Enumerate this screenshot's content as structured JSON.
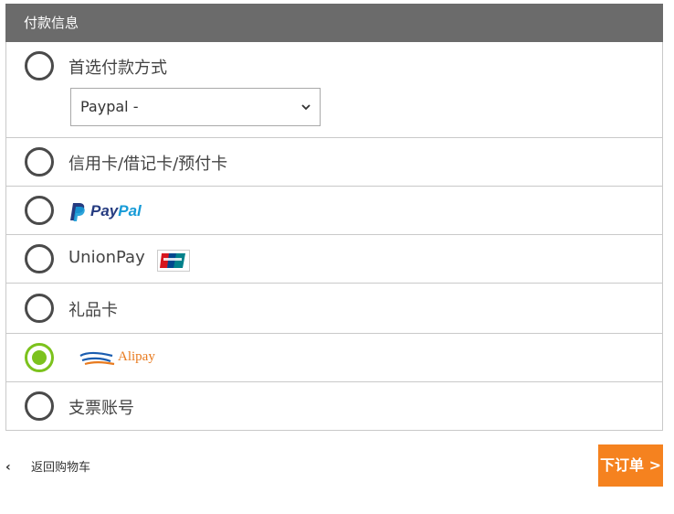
{
  "header": {
    "title": "付款信息"
  },
  "options": {
    "preferred": {
      "label": "首选付款方式",
      "select_value": "Paypal -",
      "selected": false
    },
    "card": {
      "label": "信用卡/借记卡/预付卡",
      "selected": false
    },
    "paypal": {
      "logo_part1": "Pay",
      "logo_part2": "Pal",
      "selected": false
    },
    "unionpay": {
      "label": "UnionPay",
      "selected": false
    },
    "giftcard": {
      "label": "礼品卡",
      "selected": false
    },
    "alipay": {
      "logo_text": "Alipay",
      "selected": true
    },
    "check": {
      "label": "支票账号",
      "selected": false
    }
  },
  "footer": {
    "back_chevron": "‹",
    "back_label": "返回购物车",
    "place_order_label": "下订单 >"
  },
  "colors": {
    "header_bg": "#6b6b6b",
    "selected_radio": "#7cc21d",
    "place_order_bg": "#f5821f",
    "paypal_dark": "#253b80",
    "paypal_light": "#179bd7",
    "alipay_orange": "#e87a1e"
  }
}
